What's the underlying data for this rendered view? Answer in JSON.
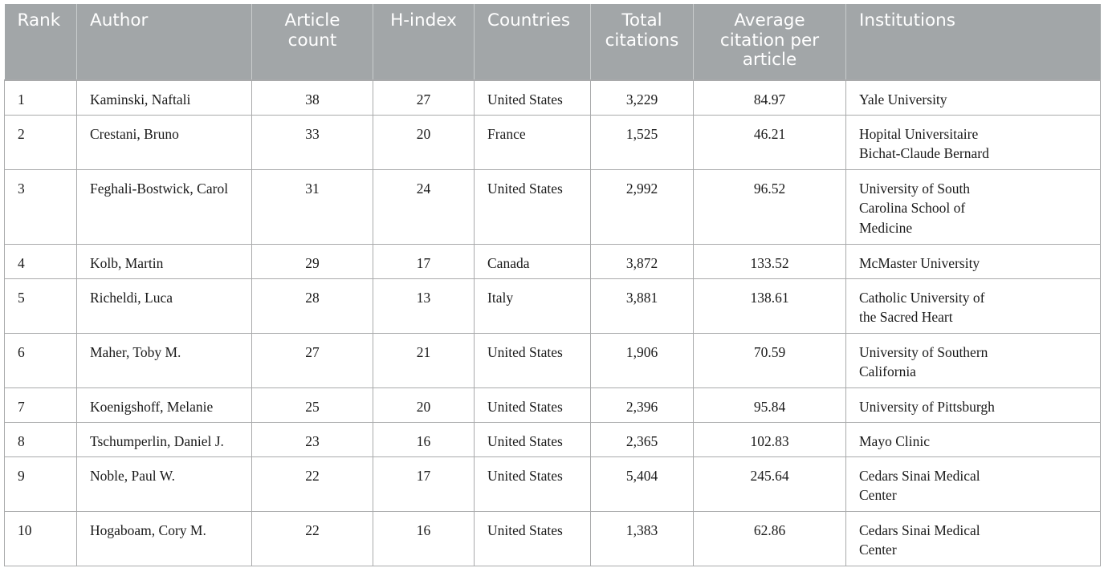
{
  "table": {
    "headers": [
      {
        "line1": "Rank",
        "line2": "",
        "line3": ""
      },
      {
        "line1": "Author",
        "line2": "",
        "line3": ""
      },
      {
        "line1": "Article",
        "line2": "count",
        "line3": ""
      },
      {
        "line1": "H-index",
        "line2": "",
        "line3": ""
      },
      {
        "line1": "Countries",
        "line2": "",
        "line3": ""
      },
      {
        "line1": "Total",
        "line2": "citations",
        "line3": ""
      },
      {
        "line1": "Average",
        "line2": "citation per",
        "line3": "article"
      },
      {
        "line1": "Institutions",
        "line2": "",
        "line3": ""
      }
    ],
    "rows": [
      {
        "rank": "1",
        "author": "Kaminski, Naftali",
        "article_count": "38",
        "h_index": "27",
        "country": "United States",
        "total_citations": "3,229",
        "avg_citation": "84.97",
        "institution": [
          "Yale University",
          "",
          ""
        ]
      },
      {
        "rank": "2",
        "author": "Crestani, Bruno",
        "article_count": "33",
        "h_index": "20",
        "country": "France",
        "total_citations": "1,525",
        "avg_citation": "46.21",
        "institution": [
          "Hopital Universitaire",
          "Bichat-Claude Bernard",
          ""
        ]
      },
      {
        "rank": "3",
        "author": "Feghali-Bostwick, Carol",
        "article_count": "31",
        "h_index": "24",
        "country": "United States",
        "total_citations": "2,992",
        "avg_citation": "96.52",
        "institution": [
          "University of South",
          "Carolina School of",
          "Medicine"
        ]
      },
      {
        "rank": "4",
        "author": "Kolb, Martin",
        "article_count": "29",
        "h_index": "17",
        "country": "Canada",
        "total_citations": "3,872",
        "avg_citation": "133.52",
        "institution": [
          "McMaster University",
          "",
          ""
        ]
      },
      {
        "rank": "5",
        "author": "Richeldi, Luca",
        "article_count": "28",
        "h_index": "13",
        "country": "Italy",
        "total_citations": "3,881",
        "avg_citation": "138.61",
        "institution": [
          "Catholic University of",
          "the Sacred Heart",
          ""
        ]
      },
      {
        "rank": "6",
        "author": "Maher, Toby M.",
        "article_count": "27",
        "h_index": "21",
        "country": "United States",
        "total_citations": "1,906",
        "avg_citation": "70.59",
        "institution": [
          "University of Southern",
          "California",
          ""
        ]
      },
      {
        "rank": "7",
        "author": "Koenigshoff, Melanie",
        "article_count": "25",
        "h_index": "20",
        "country": "United States",
        "total_citations": "2,396",
        "avg_citation": "95.84",
        "institution": [
          "University of Pittsburgh",
          "",
          ""
        ]
      },
      {
        "rank": "8",
        "author": "Tschumperlin, Daniel J.",
        "article_count": "23",
        "h_index": "16",
        "country": "United States",
        "total_citations": "2,365",
        "avg_citation": "102.83",
        "institution": [
          "Mayo Clinic",
          "",
          ""
        ]
      },
      {
        "rank": "9",
        "author": "Noble, Paul W.",
        "article_count": "22",
        "h_index": "17",
        "country": "United States",
        "total_citations": "5,404",
        "avg_citation": "245.64",
        "institution": [
          "Cedars Sinai Medical",
          "Center",
          ""
        ]
      },
      {
        "rank": "10",
        "author": "Hogaboam, Cory M.",
        "article_count": "22",
        "h_index": "16",
        "country": "United States",
        "total_citations": "1,383",
        "avg_citation": "62.86",
        "institution": [
          "Cedars Sinai Medical",
          "Center",
          ""
        ]
      }
    ]
  }
}
